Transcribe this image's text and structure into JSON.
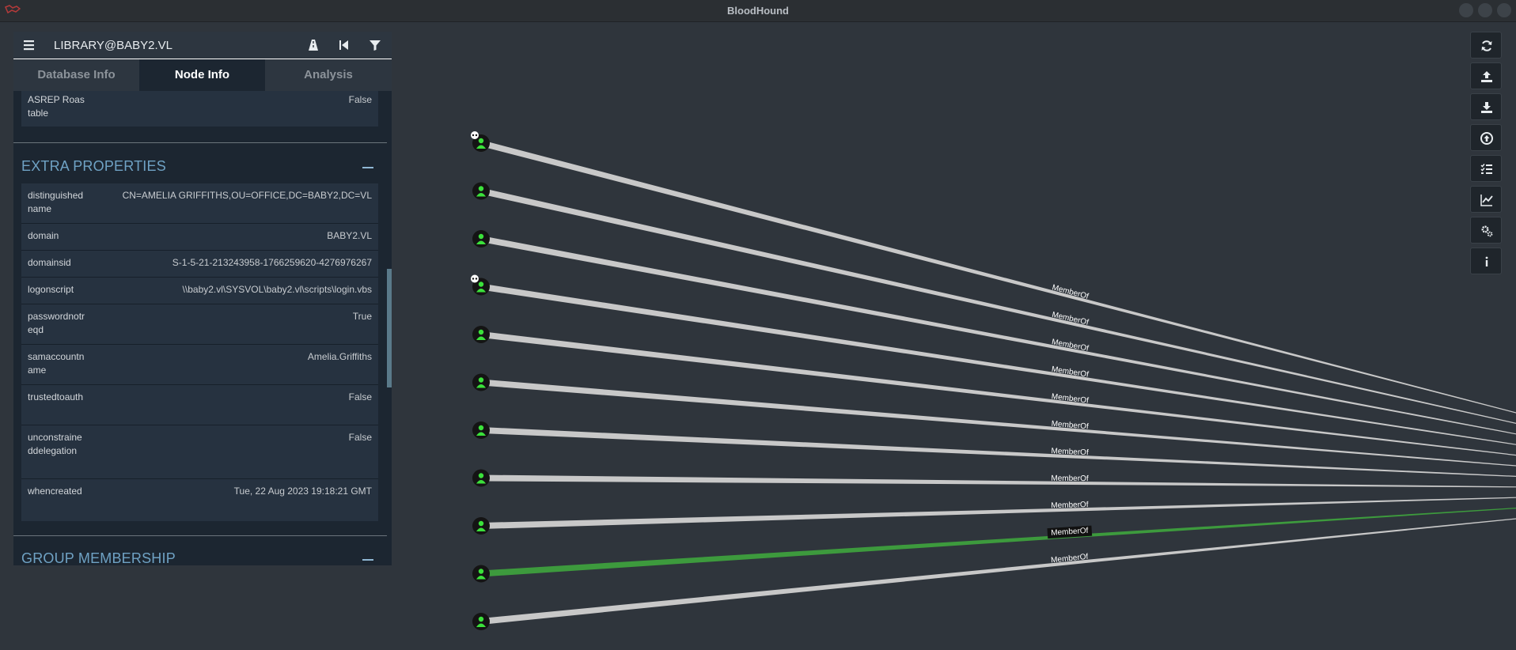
{
  "window": {
    "title": "BloodHound"
  },
  "panel": {
    "node_title": "LIBRARY@BABY2.VL",
    "tabs": [
      {
        "label": "Database Info"
      },
      {
        "label": "Node Info"
      },
      {
        "label": "Analysis"
      }
    ],
    "top_property": {
      "key": "ASREP Roastable",
      "value": "False"
    },
    "extra_properties": {
      "title": "EXTRA PROPERTIES",
      "rows": [
        {
          "key": "distinguishedname",
          "value": "CN=AMELIA GRIFFITHS,OU=OFFICE,DC=BABY2,DC=VL"
        },
        {
          "key": "domain",
          "value": "BABY2.VL"
        },
        {
          "key": "domainsid",
          "value": "S-1-5-21-213243958-1766259620-4276976267"
        },
        {
          "key": "logonscript",
          "value": "\\\\baby2.vl\\SYSVOL\\baby2.vl\\scripts\\login.vbs"
        },
        {
          "key": "passwordnotreqd",
          "value": "True"
        },
        {
          "key": "samaccountname",
          "value": "Amelia.Griffiths"
        },
        {
          "key": "trustedtoauth",
          "value": "False"
        },
        {
          "key": "unconstraineddelegation",
          "value": "False"
        },
        {
          "key": "whencreated",
          "value": "Tue, 22 Aug 2023 19:18:21 GMT"
        }
      ]
    },
    "group_membership": {
      "title": "GROUP MEMBERSHIP"
    }
  },
  "graph": {
    "edge_label": "MemberOf",
    "highlight_color": "#3d9a3d",
    "edge_color": "#c8c8c8",
    "node_icon_color": "#3be13b",
    "user_nodes": [
      {
        "icon": "user-icon",
        "owned": true
      },
      {
        "icon": "user-icon",
        "owned": false
      },
      {
        "icon": "user-icon",
        "owned": false
      },
      {
        "icon": "user-icon",
        "owned": true
      },
      {
        "icon": "user-icon",
        "owned": false
      },
      {
        "icon": "user-icon",
        "owned": false
      },
      {
        "icon": "user-icon",
        "owned": false
      },
      {
        "icon": "user-icon",
        "owned": false
      },
      {
        "icon": "user-icon",
        "owned": false
      },
      {
        "icon": "user-icon",
        "owned": false,
        "highlighted": true
      },
      {
        "icon": "user-icon",
        "owned": false
      }
    ]
  },
  "toolbar": [
    {
      "icon": "refresh-icon"
    },
    {
      "icon": "export-icon"
    },
    {
      "icon": "import-icon"
    },
    {
      "icon": "upload-icon"
    },
    {
      "icon": "queries-icon"
    },
    {
      "icon": "chart-icon"
    },
    {
      "icon": "settings-icon"
    },
    {
      "icon": "info-icon"
    }
  ]
}
